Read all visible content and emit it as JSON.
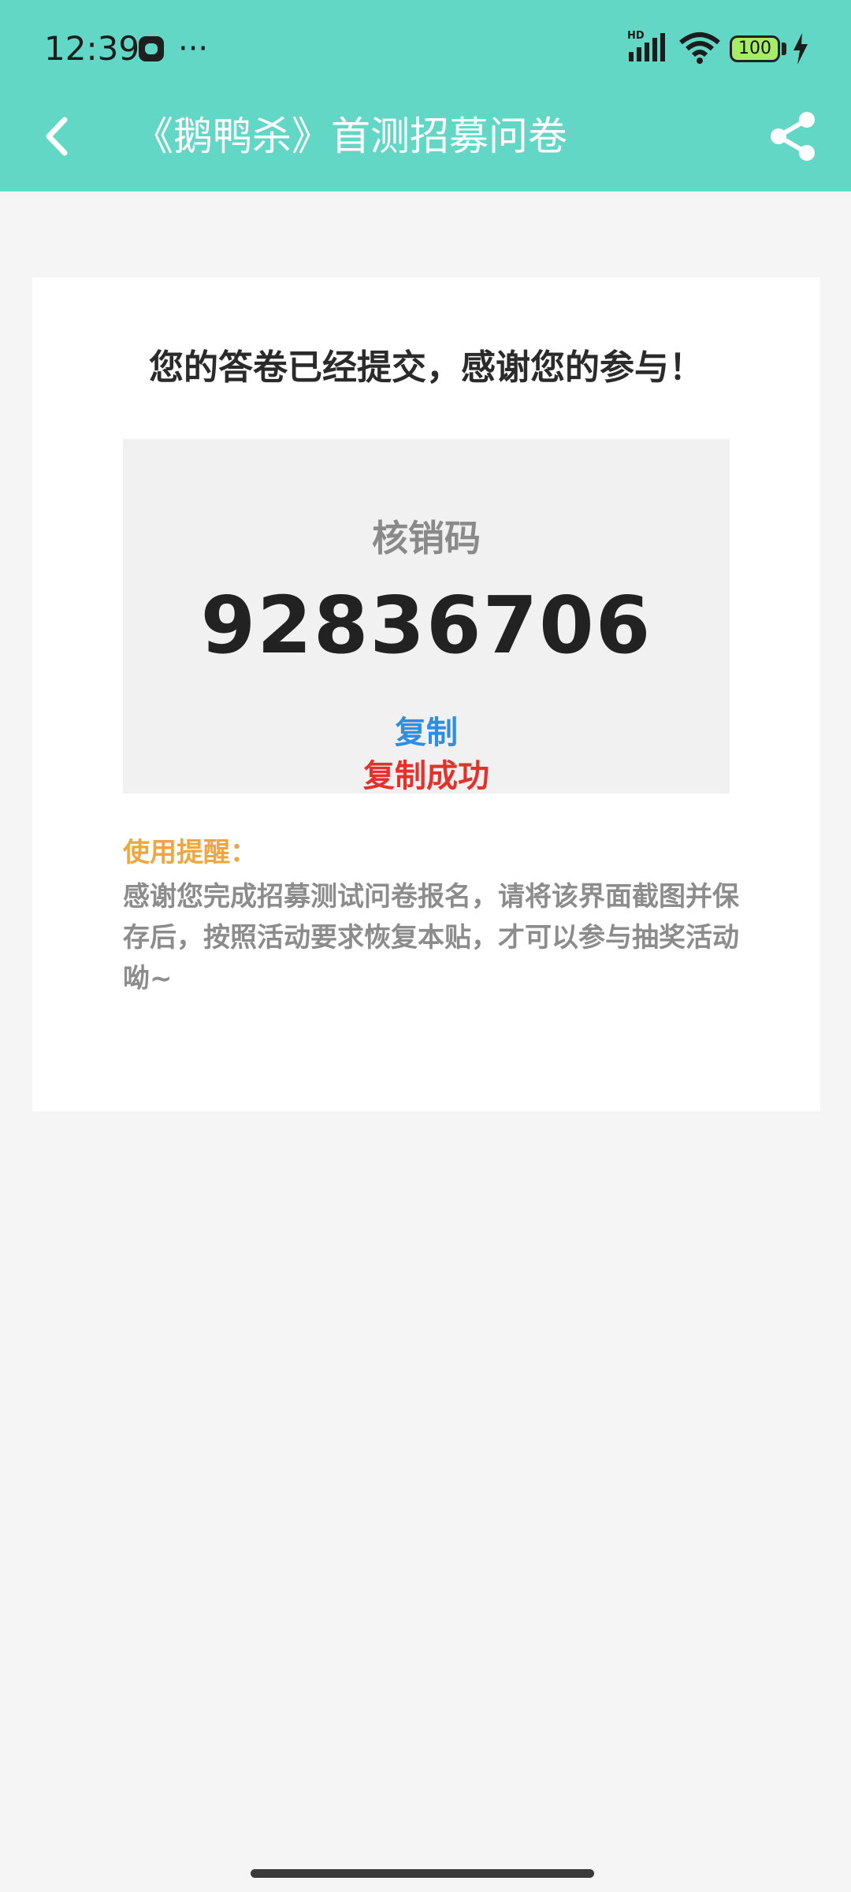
{
  "status_bar": {
    "time": "12:39",
    "more": "···",
    "network_badge": "HD",
    "battery_level": "100"
  },
  "app_bar": {
    "title": "《鹅鸭杀》首测招募问卷",
    "back_icon": "chevron-left-icon",
    "share_icon": "share-icon"
  },
  "result": {
    "headline": "您的答卷已经提交，感谢您的参与！",
    "code_label": "核销码",
    "code_value": "92836706",
    "copy_label": "复制",
    "copy_success": "复制成功"
  },
  "notice": {
    "title": "使用提醒：",
    "body": "感谢您完成招募测试问卷报名，请将该界面截图并保存后，按照活动要求恢复本贴，才可以参与抽奖活动呦~"
  },
  "colors": {
    "header": "#63d7c5",
    "link": "#2f8ee0",
    "success": "#e3322b",
    "notice_title": "#f0a640"
  }
}
